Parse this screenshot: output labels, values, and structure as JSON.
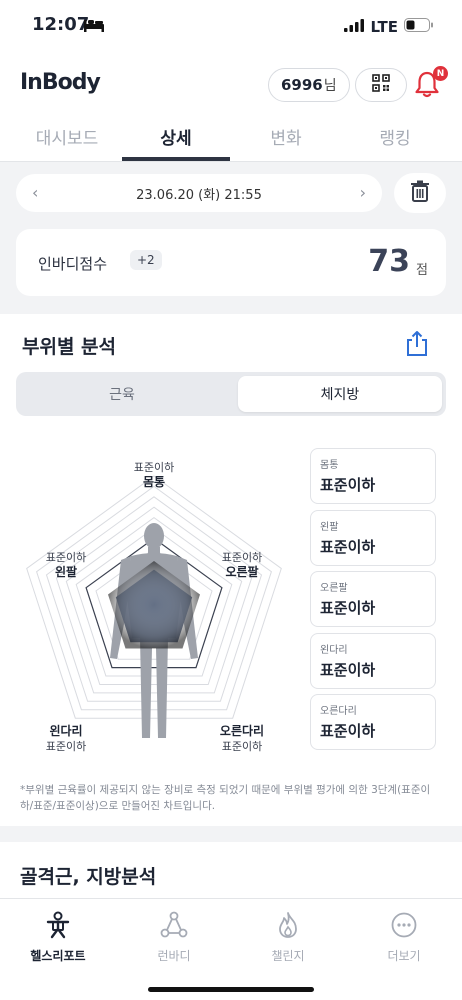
{
  "status_bar": {
    "time": "12:07",
    "network": "LTE"
  },
  "header": {
    "logo": "InBody",
    "points": "6996",
    "points_suffix": "님",
    "notification_badge": "N"
  },
  "tabs": [
    {
      "label": "대시보드",
      "active": false
    },
    {
      "label": "상세",
      "active": true
    },
    {
      "label": "변화",
      "active": false
    },
    {
      "label": "랭킹",
      "active": false
    }
  ],
  "date_nav": {
    "date": "23.06.20 (화) 21:55",
    "prev": "‹",
    "next": "›"
  },
  "score": {
    "label": "인바디점수",
    "delta": "+2",
    "value": "73",
    "unit": "점"
  },
  "segment": {
    "title": "부위별 분석",
    "toggle": [
      {
        "label": "근육",
        "active": false
      },
      {
        "label": "체지방",
        "active": true
      }
    ],
    "radar_labels": [
      {
        "level": "표준이하",
        "part": "몸통"
      },
      {
        "level": "표준이하",
        "part": "오른팔"
      },
      {
        "level": "표준이하",
        "part": "오른다리"
      },
      {
        "level": "표준이하",
        "part": "왼다리"
      },
      {
        "level": "표준이하",
        "part": "왼팔"
      }
    ],
    "cards": [
      {
        "name": "몸통",
        "value": "표준이하"
      },
      {
        "name": "왼팔",
        "value": "표준이하"
      },
      {
        "name": "오른팔",
        "value": "표준이하"
      },
      {
        "name": "왼다리",
        "value": "표준이하"
      },
      {
        "name": "오른다리",
        "value": "표준이하"
      }
    ],
    "footnote": "*부위별 근육률이 제공되지 않는 장비로 측정 되었기 때문에 부위별 평가에 의한 3단계(표준이하/표준/표준이상)으로 만들어진 차트입니다."
  },
  "section2": {
    "title": "골격근, 지방분석"
  },
  "bottom_nav": [
    {
      "label": "헬스리포트",
      "icon": "person-icon",
      "active": true
    },
    {
      "label": "런바디",
      "icon": "network-icon",
      "active": false
    },
    {
      "label": "챌린지",
      "icon": "flame-icon",
      "active": false
    },
    {
      "label": "더보기",
      "icon": "more-icon",
      "active": false
    }
  ]
}
